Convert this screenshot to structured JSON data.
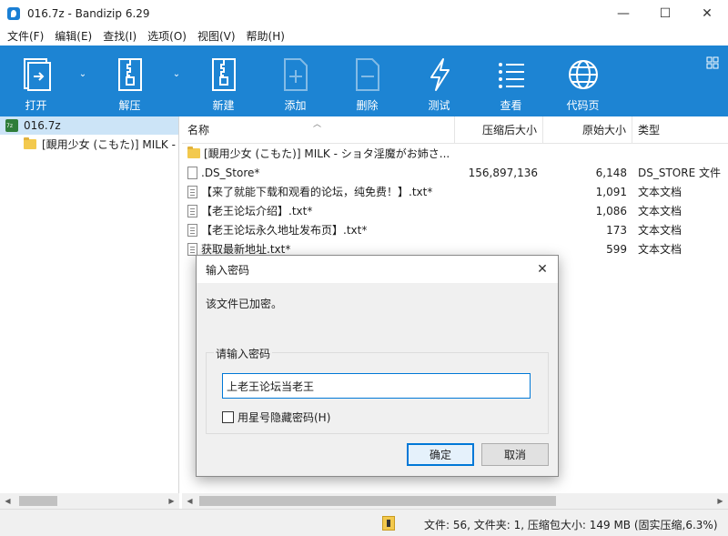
{
  "window": {
    "title": "016.7z - Bandizip 6.29",
    "controls": {
      "minimize": "—",
      "maximize": "☐",
      "close": "✕"
    }
  },
  "menu": [
    "文件(F)",
    "编辑(E)",
    "查找(I)",
    "选项(O)",
    "视图(V)",
    "帮助(H)"
  ],
  "toolbar": {
    "background": "#1d84d3",
    "buttons": [
      {
        "label": "打开",
        "icon": "open-archive-icon",
        "dropdown": true,
        "enabled": true
      },
      {
        "label": "解压",
        "icon": "extract-zip-icon",
        "dropdown": true,
        "enabled": true
      },
      {
        "label": "新建",
        "icon": "new-archive-icon",
        "dropdown": false,
        "enabled": true
      },
      {
        "label": "添加",
        "icon": "add-file-icon",
        "dropdown": false,
        "enabled": false
      },
      {
        "label": "删除",
        "icon": "delete-file-icon",
        "dropdown": false,
        "enabled": false
      },
      {
        "label": "测试",
        "icon": "lightning-icon",
        "dropdown": false,
        "enabled": true
      },
      {
        "label": "查看",
        "icon": "view-list-icon",
        "dropdown": false,
        "enabled": true
      },
      {
        "label": "代码页",
        "icon": "globe-icon",
        "dropdown": false,
        "enabled": true
      }
    ]
  },
  "tree": {
    "root": "016.7z",
    "child": "[靦用少女 (こもた)] MILK -"
  },
  "list": {
    "columns": {
      "name": "名称",
      "compressed": "压缩后大小",
      "original": "原始大小",
      "type": "类型"
    },
    "rows": [
      {
        "kind": "folder",
        "name": "[靦用少女 (こもた)] MILK - ショタ淫魔がお姉さ...",
        "compressed": "",
        "original": "",
        "type": ""
      },
      {
        "kind": "file",
        "name": ".DS_Store*",
        "compressed": "156,897,136",
        "original": "6,148",
        "type": "DS_STORE 文件"
      },
      {
        "kind": "txt",
        "name": "【来了就能下载和观看的论坛，纯免费！】.txt*",
        "compressed": "",
        "original": "1,091",
        "type": "文本文档"
      },
      {
        "kind": "txt",
        "name": "【老王论坛介绍】.txt*",
        "compressed": "",
        "original": "1,086",
        "type": "文本文档"
      },
      {
        "kind": "txt",
        "name": "【老王论坛永久地址发布页】.txt*",
        "compressed": "",
        "original": "173",
        "type": "文本文档"
      },
      {
        "kind": "txt",
        "name": "获取最新地址.txt*",
        "compressed": "",
        "original": "599",
        "type": "文本文档"
      }
    ]
  },
  "status": {
    "text": "文件: 56, 文件夹: 1, 压缩包大小: 149 MB (固实压缩,6.3%)"
  },
  "dialog": {
    "title": "输入密码",
    "message": "该文件已加密。",
    "group_label": "请输入密码",
    "password_value": "上老王论坛当老王",
    "hide_label": "用星号隐藏密码(H)",
    "ok_label": "确定",
    "cancel_label": "取消",
    "close": "✕"
  }
}
